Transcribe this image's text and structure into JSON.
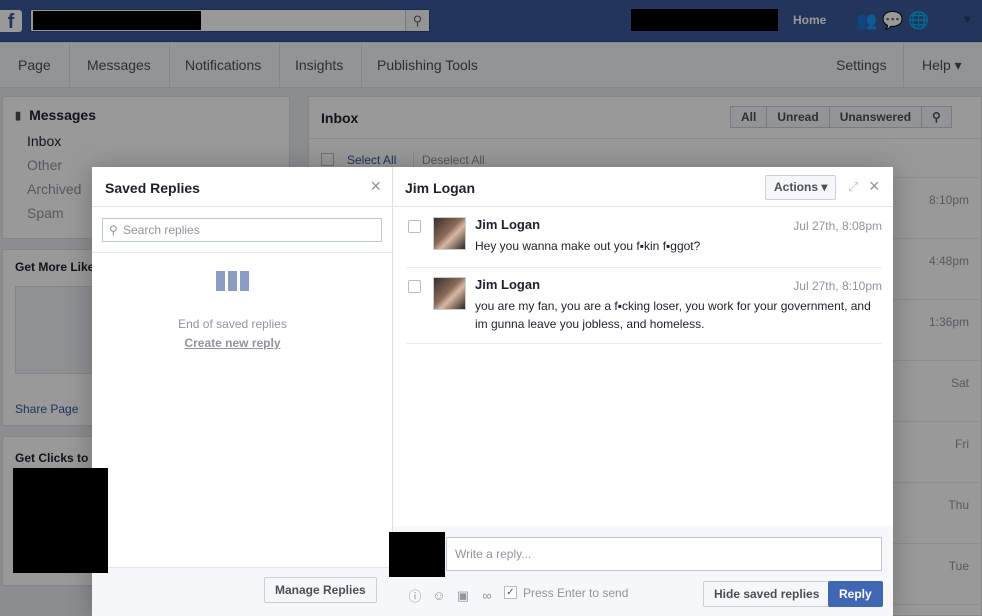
{
  "topbar": {
    "logo": "f",
    "home": "Home",
    "icons": [
      "friends-icon",
      "messages-icon",
      "globe-icon"
    ]
  },
  "pagenav": {
    "items": [
      "Page",
      "Messages",
      "Notifications",
      "Insights",
      "Publishing Tools"
    ],
    "settings": "Settings",
    "help": "Help ▾"
  },
  "left": {
    "messages_title": "Messages",
    "folders": [
      "Inbox",
      "Other",
      "Archived",
      "Spam"
    ],
    "get_more_likes": "Get More Like",
    "share_page": "Share Page",
    "get_clicks": "Get Clicks to Y"
  },
  "inbox": {
    "title": "Inbox",
    "filters": [
      "All",
      "Unread",
      "Unanswered"
    ],
    "select_all": "Select All",
    "deselect_all": "Deselect All",
    "times": [
      "8:10pm",
      "4:48pm",
      "1:36pm",
      "Sat",
      "Fri",
      "Thu",
      "Tue"
    ]
  },
  "saved_replies": {
    "title": "Saved Replies",
    "search_placeholder": "Search replies",
    "end_text": "End of saved replies",
    "create_link": "Create new reply",
    "manage_button": "Manage Replies"
  },
  "conversation": {
    "title": "Jim Logan",
    "actions_button": "Actions ▾",
    "messages": [
      {
        "sender": "Jim Logan",
        "time": "Jul 27th, 8:08pm",
        "body": "Hey you wanna make out you f▪kin f▪ggot?"
      },
      {
        "sender": "Jim Logan",
        "time": "Jul 27th, 8:10pm",
        "body": "you are my fan, you are a f▪cking loser, you work for your government, and im gunna leave you jobless, and homeless."
      }
    ],
    "reply_placeholder": "Write a reply...",
    "press_enter": "Press Enter to send",
    "hide_button": "Hide saved replies",
    "reply_button": "Reply"
  }
}
